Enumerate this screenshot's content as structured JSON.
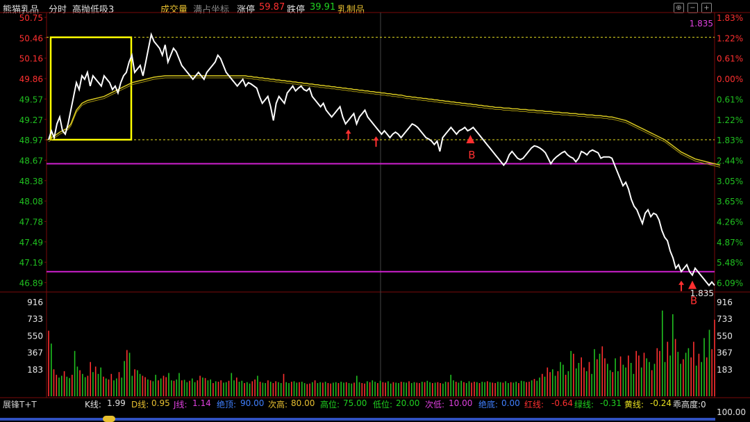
{
  "header": {
    "title": "熊猫乳品",
    "mode": "分时",
    "indicator": "高抛低吸3",
    "volume_label": "成交量",
    "coordinate_label": "满占坐标",
    "limit_up_label": "涨停",
    "limit_up_value": "59.87",
    "limit_down_label": "跌停",
    "limit_down_value": "39.91",
    "sector": "乳制品"
  },
  "icons": {
    "target": "crosshair-icon",
    "minus": "zoom-out-icon",
    "plus": "zoom-in-icon"
  },
  "colors": {
    "price_line": "#ffffff",
    "avg_line": "#d8c820",
    "box": "#ffff00",
    "support_line": "#d020d0",
    "up": "#ff3030",
    "down": "#20c020",
    "grid": "#7a0a0a"
  },
  "chart_data": [
    {
      "type": "line",
      "name": "intraday-price",
      "left_axis_ticks": [
        "50.75",
        "50.46",
        "50.16",
        "49.86",
        "49.57",
        "49.27",
        "48.97",
        "48.67",
        "48.38",
        "48.08",
        "47.78",
        "47.49",
        "47.19",
        "46.89"
      ],
      "right_axis_ticks": [
        "1.83%",
        "1.22%",
        "0.61%",
        "0.00%",
        "0.61%",
        "1.22%",
        "1.83%",
        "2.44%",
        "3.05%",
        "3.65%",
        "4.26%",
        "4.87%",
        "5.48%",
        "6.09%"
      ],
      "ylim": [
        46.74,
        50.75
      ],
      "dashed_levels": [
        50.46,
        48.97
      ],
      "support_levels": [
        48.62,
        47.05
      ],
      "top_right_label": "1.835",
      "last_price_label": "1.835",
      "price": [
        48.97,
        49.1,
        49.0,
        49.2,
        49.3,
        49.1,
        49.05,
        49.2,
        49.4,
        49.6,
        49.8,
        49.7,
        49.9,
        49.85,
        49.95,
        49.75,
        49.9,
        49.85,
        49.8,
        49.75,
        49.9,
        49.85,
        49.8,
        49.7,
        49.75,
        49.65,
        49.8,
        49.9,
        49.95,
        50.1,
        50.2,
        49.95,
        50.0,
        50.05,
        49.9,
        50.1,
        50.3,
        50.5,
        50.4,
        50.35,
        50.3,
        50.2,
        50.35,
        50.1,
        50.2,
        50.3,
        50.25,
        50.15,
        50.05,
        50.0,
        49.95,
        49.9,
        49.85,
        49.9,
        49.95,
        49.9,
        49.85,
        49.95,
        50.0,
        50.05,
        50.1,
        50.2,
        50.15,
        50.05,
        49.95,
        49.9,
        49.85,
        49.8,
        49.75,
        49.8,
        49.85,
        49.75,
        49.8,
        49.78,
        49.75,
        49.72,
        49.6,
        49.5,
        49.55,
        49.6,
        49.45,
        49.25,
        49.5,
        49.6,
        49.55,
        49.5,
        49.65,
        49.7,
        49.75,
        49.68,
        49.72,
        49.75,
        49.7,
        49.68,
        49.72,
        49.6,
        49.55,
        49.5,
        49.45,
        49.5,
        49.4,
        49.35,
        49.3,
        49.35,
        49.4,
        49.45,
        49.3,
        49.2,
        49.25,
        49.3,
        49.35,
        49.2,
        49.3,
        49.35,
        49.4,
        49.3,
        49.25,
        49.2,
        49.15,
        49.1,
        49.05,
        49.1,
        49.05,
        49.0,
        49.05,
        49.08,
        49.05,
        49.0,
        49.05,
        49.1,
        49.15,
        49.2,
        49.18,
        49.15,
        49.1,
        49.05,
        49.0,
        48.98,
        48.95,
        48.9,
        48.95,
        48.8,
        49.0,
        49.05,
        49.1,
        49.15,
        49.1,
        49.05,
        49.1,
        49.12,
        49.15,
        49.1,
        49.12,
        49.15,
        49.1,
        49.05,
        49.0,
        48.95,
        48.9,
        48.85,
        48.8,
        48.75,
        48.7,
        48.65,
        48.6,
        48.65,
        48.75,
        48.8,
        48.75,
        48.7,
        48.68,
        48.7,
        48.75,
        48.8,
        48.85,
        48.88,
        48.87,
        48.85,
        48.82,
        48.78,
        48.7,
        48.62,
        48.68,
        48.72,
        48.75,
        48.78,
        48.8,
        48.75,
        48.72,
        48.7,
        48.65,
        48.7,
        48.8,
        48.78,
        48.75,
        48.8,
        48.82,
        48.8,
        48.78,
        48.7,
        48.72,
        48.72,
        48.72,
        48.7,
        48.6,
        48.5,
        48.4,
        48.3,
        48.35,
        48.25,
        48.1,
        48.0,
        47.95,
        47.85,
        47.75,
        47.9,
        47.95,
        47.85,
        47.9,
        47.88,
        47.8,
        47.65,
        47.55,
        47.5,
        47.35,
        47.25,
        47.1,
        47.15,
        47.05,
        47.1,
        47.15,
        47.05,
        47.0,
        47.1,
        47.05,
        47.0,
        46.95,
        46.9,
        46.85,
        46.9,
        46.85
      ],
      "avg": [
        48.97,
        49.0,
        49.02,
        49.05,
        49.08,
        49.1,
        49.12,
        49.15,
        49.2,
        49.3,
        49.4,
        49.45,
        49.5,
        49.52,
        49.54,
        49.55,
        49.56,
        49.57,
        49.58,
        49.59,
        49.6,
        49.62,
        49.64,
        49.66,
        49.68,
        49.7,
        49.72,
        49.74,
        49.76,
        49.78,
        49.8,
        49.81,
        49.82,
        49.83,
        49.84,
        49.85,
        49.86,
        49.87,
        49.88,
        49.885,
        49.89,
        49.895,
        49.9,
        49.9,
        49.9,
        49.9,
        49.9,
        49.9,
        49.9,
        49.9,
        49.9,
        49.9,
        49.9,
        49.9,
        49.9,
        49.9,
        49.9,
        49.9,
        49.9,
        49.9,
        49.9,
        49.9,
        49.9,
        49.9,
        49.9,
        49.9,
        49.9,
        49.9,
        49.9,
        49.9,
        49.9,
        49.9,
        49.89,
        49.89,
        49.88,
        49.88,
        49.87,
        49.87,
        49.86,
        49.86,
        49.85,
        49.85,
        49.84,
        49.84,
        49.83,
        49.83,
        49.82,
        49.82,
        49.81,
        49.81,
        49.8,
        49.8,
        49.79,
        49.79,
        49.78,
        49.78,
        49.77,
        49.77,
        49.76,
        49.76,
        49.75,
        49.75,
        49.74,
        49.74,
        49.73,
        49.73,
        49.72,
        49.72,
        49.71,
        49.71,
        49.7,
        49.7,
        49.69,
        49.69,
        49.68,
        49.68,
        49.67,
        49.67,
        49.66,
        49.66,
        49.65,
        49.65,
        49.64,
        49.64,
        49.63,
        49.63,
        49.62,
        49.62,
        49.61,
        49.6,
        49.6,
        49.59,
        49.59,
        49.58,
        49.58,
        49.57,
        49.57,
        49.56,
        49.56,
        49.55,
        49.55,
        49.54,
        49.54,
        49.53,
        49.53,
        49.52,
        49.52,
        49.51,
        49.51,
        49.5,
        49.5,
        49.49,
        49.49,
        49.48,
        49.48,
        49.47,
        49.47,
        49.46,
        49.46,
        49.45,
        49.45,
        49.44,
        49.44,
        49.44,
        49.43,
        49.43,
        49.43,
        49.42,
        49.42,
        49.42,
        49.41,
        49.41,
        49.41,
        49.4,
        49.4,
        49.4,
        49.39,
        49.39,
        49.39,
        49.38,
        49.38,
        49.38,
        49.37,
        49.37,
        49.37,
        49.36,
        49.36,
        49.36,
        49.35,
        49.35,
        49.35,
        49.34,
        49.34,
        49.34,
        49.33,
        49.33,
        49.33,
        49.32,
        49.32,
        49.32,
        49.31,
        49.31,
        49.3,
        49.3,
        49.29,
        49.28,
        49.27,
        49.26,
        49.25,
        49.23,
        49.21,
        49.19,
        49.17,
        49.15,
        49.13,
        49.11,
        49.09,
        49.07,
        49.05,
        49.03,
        49.01,
        48.99,
        48.97,
        48.94,
        48.91,
        48.88,
        48.85,
        48.82,
        48.79,
        48.77,
        48.75,
        48.73,
        48.71,
        48.69,
        48.68,
        48.67,
        48.66,
        48.65,
        48.64,
        48.63,
        48.62,
        48.61,
        48.6
      ],
      "buy_markers": [
        {
          "index": 152,
          "label": "B"
        },
        {
          "index": 232,
          "label": "B"
        }
      ],
      "arrow_markers": [
        108,
        118,
        228
      ]
    },
    {
      "type": "bar",
      "name": "volume",
      "axis_ticks": [
        "916",
        "733",
        "550",
        "367",
        "183"
      ],
      "ylim": [
        0,
        916
      ],
      "values": [
        600,
        460,
        180,
        120,
        90,
        110,
        160,
        100,
        85,
        120,
        380,
        210,
        170,
        130,
        95,
        110,
        260,
        150,
        210,
        130,
        200,
        100,
        80,
        70,
        130,
        60,
        80,
        150,
        90,
        270,
        390,
        360,
        110,
        180,
        170,
        130,
        110,
        95,
        70,
        60,
        50,
        120,
        60,
        80,
        110,
        95,
        140,
        60,
        55,
        70,
        140,
        60,
        65,
        40,
        55,
        80,
        40,
        60,
        110,
        90,
        85,
        60,
        70,
        30,
        50,
        45,
        60,
        35,
        40,
        55,
        140,
        60,
        90,
        45,
        55,
        30,
        40,
        25,
        50,
        70,
        110,
        45,
        35,
        30,
        60,
        45,
        30,
        50,
        40,
        30,
        130,
        40,
        30,
        45,
        50,
        35,
        40,
        45,
        30,
        20,
        25,
        40,
        60,
        30,
        40,
        35,
        45,
        30,
        25,
        35,
        40,
        30,
        45,
        35,
        40,
        30,
        25,
        35,
        110,
        40,
        30,
        25,
        50,
        40,
        60,
        45,
        30,
        55,
        40,
        35,
        50,
        25,
        40,
        35,
        30,
        45,
        40,
        35,
        50,
        30,
        40,
        35,
        30,
        45,
        40,
        55,
        40,
        30,
        35,
        40,
        30,
        25,
        45,
        40,
        120,
        60,
        45,
        35,
        55,
        40,
        30,
        50,
        35,
        45,
        40,
        30,
        45,
        40,
        50,
        40,
        35,
        30,
        45,
        40,
        35,
        50,
        30,
        40,
        35,
        45,
        30,
        55,
        50,
        40,
        45,
        60,
        75,
        55,
        90,
        130,
        100,
        200,
        150,
        180,
        110,
        160,
        260,
        230,
        120,
        160,
        380,
        350,
        190,
        250,
        310,
        200,
        160,
        260,
        130,
        400,
        290,
        350,
        430,
        300,
        240,
        170,
        150,
        300,
        160,
        320,
        230,
        200,
        330,
        250,
        130,
        380,
        330,
        200,
        360,
        300,
        260,
        170,
        240,
        410,
        380,
        820,
        260,
        480,
        330,
        780,
        510,
        370,
        240,
        290,
        360,
        410,
        310,
        480,
        220,
        350,
        260,
        520,
        310,
        610,
        400,
        720
      ]
    }
  ],
  "bottom_bar": {
    "name": "展锋T+T",
    "k_label": "K线:",
    "k_value": "1.99",
    "d_label": "D线:",
    "d_value": "0.95",
    "j_label": "J线:",
    "j_value": "1.14",
    "top_label": "绝顶:",
    "top_value": "90.00",
    "sub_high_label": "次高:",
    "sub_high_value": "80.00",
    "high_label": "高位:",
    "high_value": "75.00",
    "low_label": "低位:",
    "low_value": "20.00",
    "sub_low_label": "次低:",
    "sub_low_value": "10.00",
    "bottom_label": "绝底:",
    "bottom_value": "0.00",
    "red_label": "红线:",
    "red_value": "-0.64",
    "green_label": "绿线:",
    "green_value": "-0.31",
    "yellow_label": "黄线:",
    "yellow_value": "-0.24",
    "extra_label": "乖高度:0",
    "right_scale": "100.00"
  }
}
